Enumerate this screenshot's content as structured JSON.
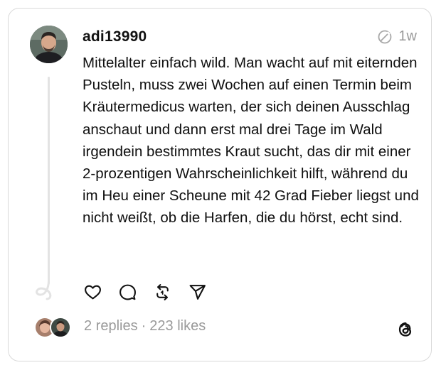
{
  "post": {
    "username": "adi13990",
    "time": "1w",
    "text": "Mittelalter einfach wild. Man wacht auf mit eiternden Pusteln, muss zwei Wochen auf einen Termin beim Kräutermedicus warten, der sich deinen Ausschlag anschaut und dann erst mal drei Tage im Wald irgendein bestimmtes Kraut sucht, das dir mit einer 2-prozentigen Wahrscheinlichkeit hilft, während du im Heu einer Scheune mit 42 Grad Fieber liegst und nicht weißt, ob die Harfen, die du hörst, echt sind."
  },
  "stats": {
    "replies": "2 replies",
    "separator": "·",
    "likes": "223 likes"
  },
  "icons": {
    "actions": [
      "heart-icon",
      "comment-icon",
      "repost-icon",
      "share-icon"
    ],
    "meta": "ai-info-icon",
    "brand": "threads-logo-icon"
  },
  "colors": {
    "text": "#101010",
    "muted": "#9a9a9a",
    "border": "#d9d9d9"
  }
}
